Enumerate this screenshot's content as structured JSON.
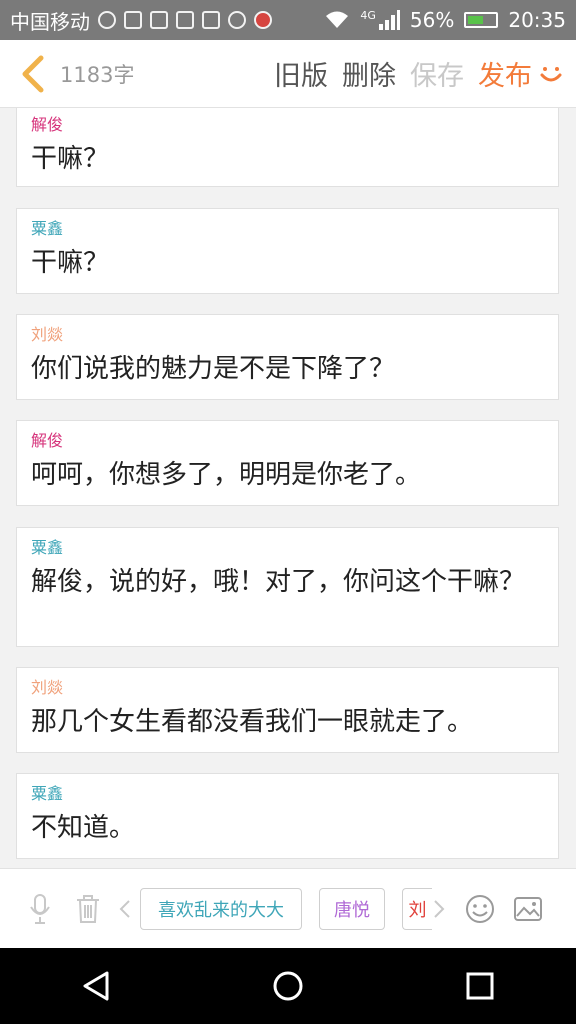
{
  "status_bar": {
    "carrier": "中国移动",
    "network": "4G",
    "battery": "56%",
    "time": "20:35"
  },
  "header": {
    "word_count": "1183字",
    "old_version": "旧版",
    "delete": "删除",
    "save": "保存",
    "publish": "发布"
  },
  "colors": {
    "xiejun": "#d6357c",
    "suxin": "#3fa6b8",
    "liuyan": "#f0a17b",
    "tangyue": "#b06ad6",
    "accent": "#f37b3a"
  },
  "messages": [
    {
      "speaker": "解俊",
      "text": "干嘛？"
    },
    {
      "speaker": "粟鑫",
      "text": "干嘛？"
    },
    {
      "speaker": "刘燚",
      "text": "你们说我的魅力是不是下降了？"
    },
    {
      "speaker": "解俊",
      "text": "呵呵，你想多了，明明是你老了。"
    },
    {
      "speaker": "粟鑫",
      "text": "解俊，说的好，哦！对了，你问这个干嘛？"
    },
    {
      "speaker": "刘燚",
      "text": "那几个女生看都没看我们一眼就走了。"
    },
    {
      "speaker": "粟鑫",
      "text": "不知道。"
    }
  ],
  "toolbar": {
    "chips": [
      "喜欢乱来的大大",
      "唐悦",
      "刘"
    ],
    "icons": [
      "microphone-icon",
      "trash-icon",
      "chevron-left-icon",
      "chevron-right-icon",
      "emoji-icon",
      "image-icon"
    ]
  }
}
